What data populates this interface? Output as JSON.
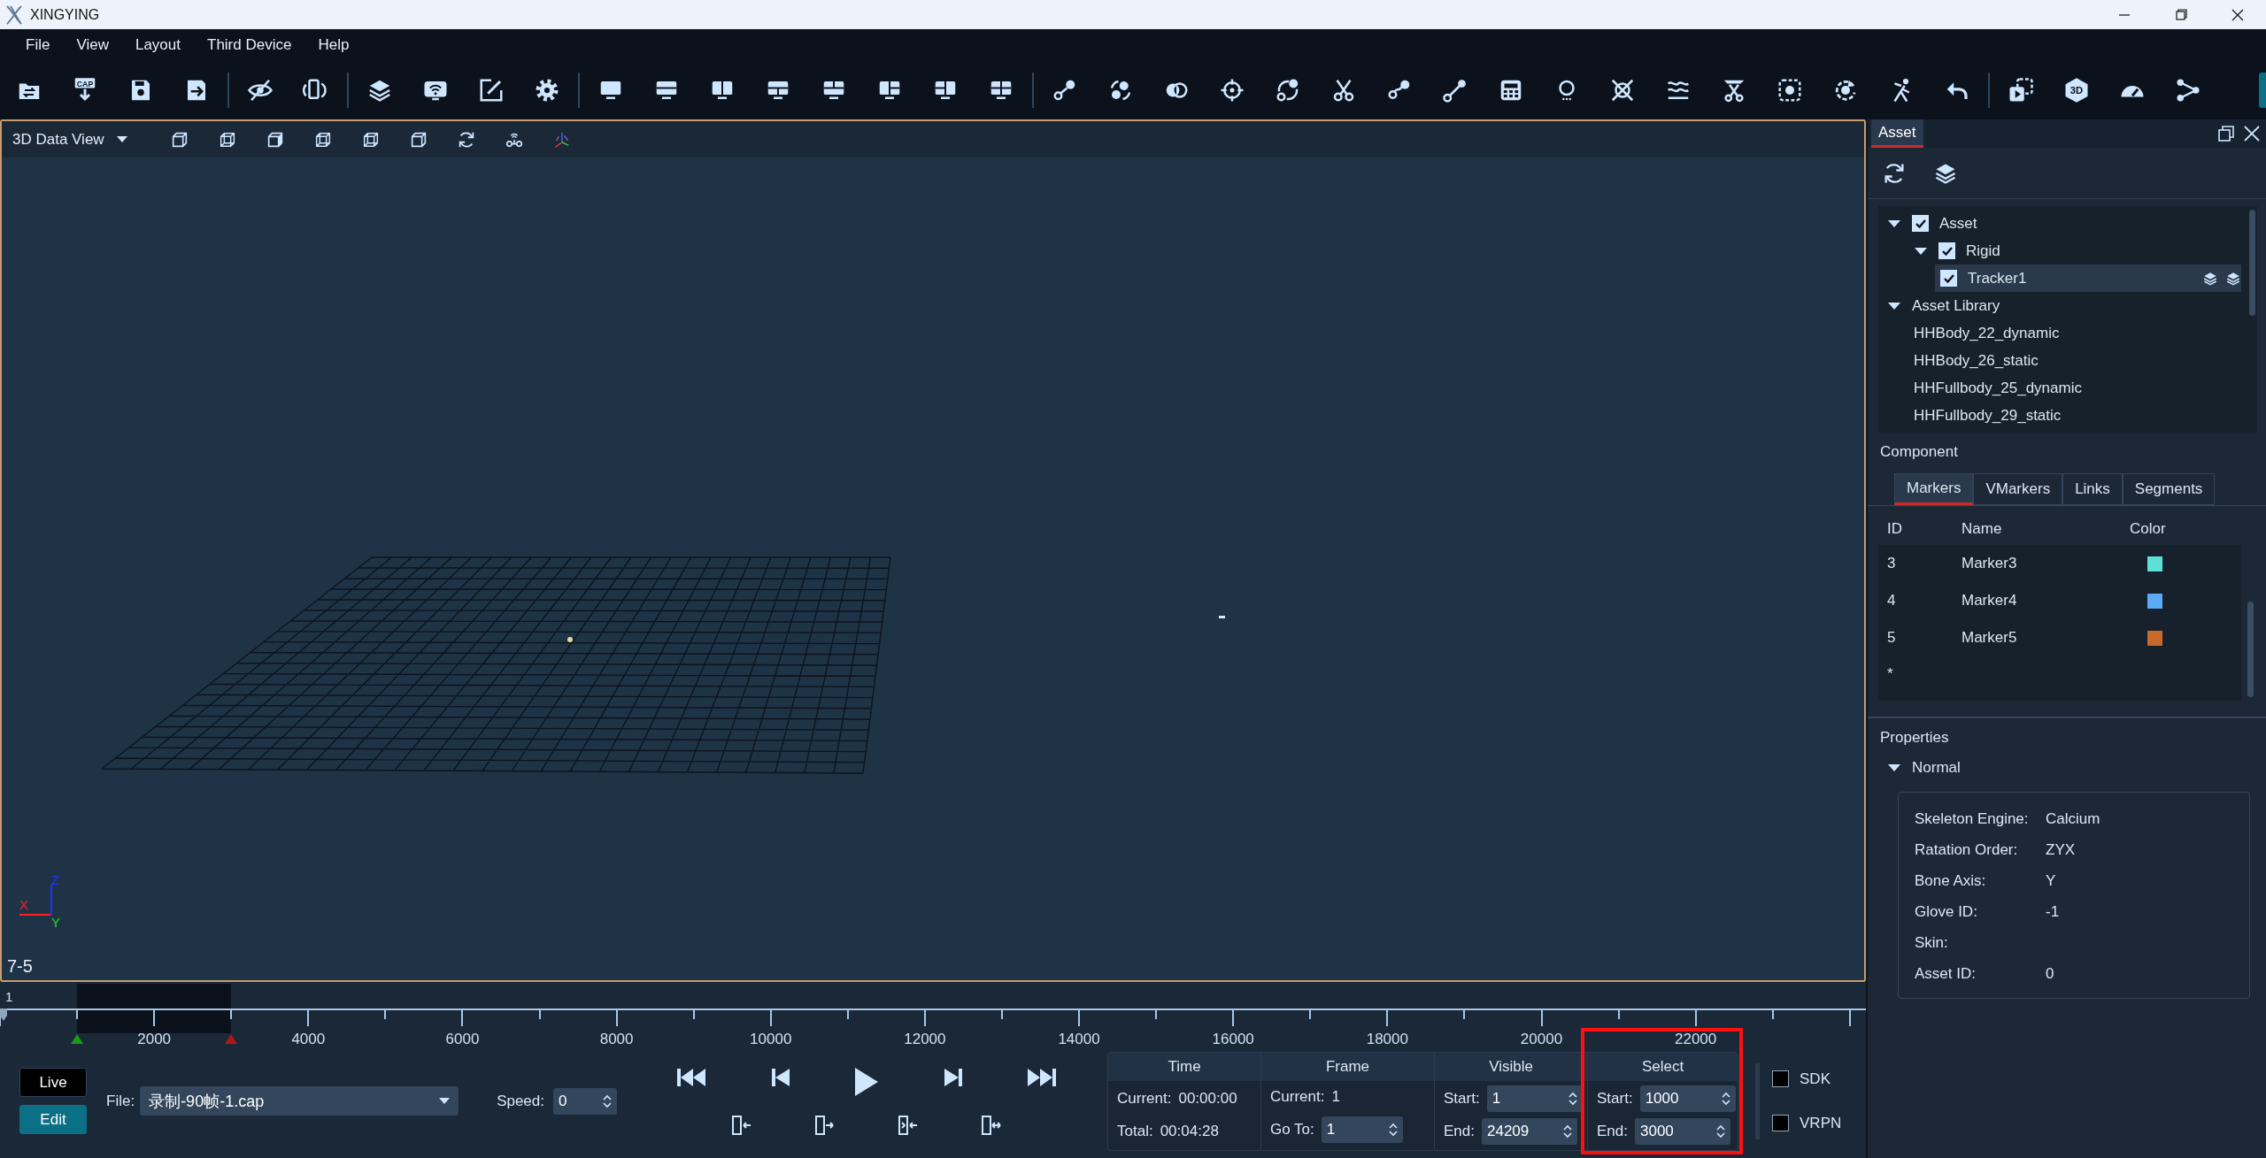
{
  "window": {
    "title": "XINGYING"
  },
  "menu": [
    "File",
    "View",
    "Layout",
    "Third Device",
    "Help"
  ],
  "toolbar": {
    "groups": [
      [
        {
          "kind": "folder-swap"
        },
        {
          "kind": "download",
          "label": "CAP"
        },
        {
          "kind": "save"
        },
        {
          "kind": "save-export"
        }
      ],
      [
        {
          "kind": "eye-off"
        },
        {
          "kind": "phone-rotate"
        }
      ],
      [
        {
          "kind": "layers"
        },
        {
          "kind": "wifi-screen"
        },
        {
          "kind": "edit"
        },
        {
          "kind": "gear"
        }
      ],
      [
        {
          "kind": "layout-1"
        },
        {
          "kind": "layout-2h"
        },
        {
          "kind": "layout-2v"
        },
        {
          "kind": "layout-3t"
        },
        {
          "kind": "layout-3b"
        },
        {
          "kind": "layout-3r"
        },
        {
          "kind": "layout-3l"
        },
        {
          "kind": "layout-4"
        }
      ],
      [
        {
          "kind": "node-link"
        },
        {
          "kind": "cycle-dots"
        },
        {
          "kind": "overlap"
        },
        {
          "kind": "crosshair"
        },
        {
          "kind": "curve-link"
        },
        {
          "kind": "scissors"
        },
        {
          "kind": "wave-link"
        },
        {
          "kind": "line-link"
        },
        {
          "kind": "calculator"
        },
        {
          "kind": "bulb"
        },
        {
          "kind": "crossed-circle"
        },
        {
          "kind": "waves"
        },
        {
          "kind": "scissors-bar"
        },
        {
          "kind": "dotted-square"
        },
        {
          "kind": "rotate-dot"
        },
        {
          "kind": "figure"
        },
        {
          "kind": "undo"
        }
      ],
      [
        {
          "kind": "play-square"
        },
        {
          "kind": "hexagon",
          "label": "3D"
        },
        {
          "kind": "gauge"
        },
        {
          "kind": "share"
        }
      ]
    ]
  },
  "view_toolbar": {
    "view_select": "3D Data View",
    "tools": [
      {
        "kind": "cube-front"
      },
      {
        "kind": "cube-wire"
      },
      {
        "kind": "cube-side"
      },
      {
        "kind": "cube-wire"
      },
      {
        "kind": "cube-wire"
      },
      {
        "kind": "cube-front"
      },
      {
        "kind": "refresh"
      },
      {
        "kind": "camera-rig"
      },
      {
        "kind": "axes"
      }
    ]
  },
  "viewport": {
    "axis_labels": {
      "x": "X",
      "y": "Y",
      "z": "Z"
    },
    "corner_label": "7-5"
  },
  "asset_panel": {
    "tab": "Asset",
    "tree": [
      {
        "label": "Asset",
        "checked": true,
        "expanded": true,
        "selected": false,
        "children": [
          {
            "label": "Rigid",
            "checked": true,
            "expanded": true,
            "selected": false,
            "children": [
              {
                "label": "Tracker1",
                "checked": true,
                "selected": true
              }
            ]
          }
        ]
      },
      {
        "label": "Asset Library",
        "expanded": true,
        "selected": false,
        "children": [
          {
            "label": "HHBody_22_dynamic",
            "selected": false
          },
          {
            "label": "HHBody_26_static",
            "selected": false
          },
          {
            "label": "HHFullbody_25_dynamic",
            "selected": false
          },
          {
            "label": "HHFullbody_29_static",
            "selected": false
          }
        ]
      }
    ]
  },
  "component": {
    "title": "Component",
    "tabs": [
      {
        "label": "Markers",
        "selected": true
      },
      {
        "label": "VMarkers",
        "selected": false
      },
      {
        "label": "Links",
        "selected": false
      },
      {
        "label": "Segments",
        "selected": false
      }
    ],
    "columns": [
      "ID",
      "Name",
      "Color"
    ],
    "rows": [
      {
        "id": "3",
        "name": "Marker3",
        "color": "#5ee0d8"
      },
      {
        "id": "4",
        "name": "Marker4",
        "color": "#5aaaf5"
      },
      {
        "id": "5",
        "name": "Marker5",
        "color": "#c8692a"
      }
    ],
    "new_row": "*"
  },
  "properties": {
    "title": "Properties",
    "section": {
      "label": "Normal",
      "expanded": true,
      "fields": [
        {
          "label": "Skeleton Engine:",
          "value": "Calcium"
        },
        {
          "label": "Ratation Order:",
          "value": "ZYX"
        },
        {
          "label": "Bone Axis:",
          "value": "Y"
        },
        {
          "label": "Glove ID:",
          "value": "-1"
        },
        {
          "label": "Skin:"
        },
        {
          "label": "Asset ID:",
          "value": "0"
        }
      ]
    }
  },
  "timeline": {
    "start_label": "1",
    "ticks": [
      "2000",
      "4000",
      "6000",
      "8000",
      "10000",
      "12000",
      "14000",
      "16000",
      "18000",
      "20000",
      "22000"
    ]
  },
  "controls": {
    "modes": [
      {
        "label": "Live",
        "selected": false
      },
      {
        "label": "Edit",
        "selected": true
      }
    ],
    "file": {
      "label": "File:",
      "value": "录制-90帧-1.cap"
    },
    "speed": {
      "label": "Speed:",
      "value": "0"
    },
    "info": [
      {
        "title": "Time",
        "highlight": false,
        "rows": [
          {
            "label": "Current:",
            "value": "00:00:00",
            "kind": "text"
          },
          {
            "label": "Total:",
            "value": "00:04:28",
            "kind": "text"
          }
        ]
      },
      {
        "title": "Frame",
        "highlight": false,
        "rows": [
          {
            "label": "Current:",
            "value": "1",
            "kind": "text"
          },
          {
            "label": "Go To:",
            "value": "1",
            "kind": "spin"
          }
        ]
      },
      {
        "title": "Visible",
        "highlight": false,
        "rows": [
          {
            "label": "Start:",
            "value": "1",
            "kind": "spin"
          },
          {
            "label": "End:",
            "value": "24209",
            "kind": "spin"
          }
        ]
      },
      {
        "title": "Select",
        "highlight": true,
        "rows": [
          {
            "label": "Start:",
            "value": "1000",
            "kind": "spin"
          },
          {
            "label": "End:",
            "value": "3000",
            "kind": "spin"
          }
        ]
      }
    ],
    "outputs": [
      {
        "label": "SDK",
        "checked": false
      },
      {
        "label": "VRPN",
        "checked": false
      }
    ]
  }
}
